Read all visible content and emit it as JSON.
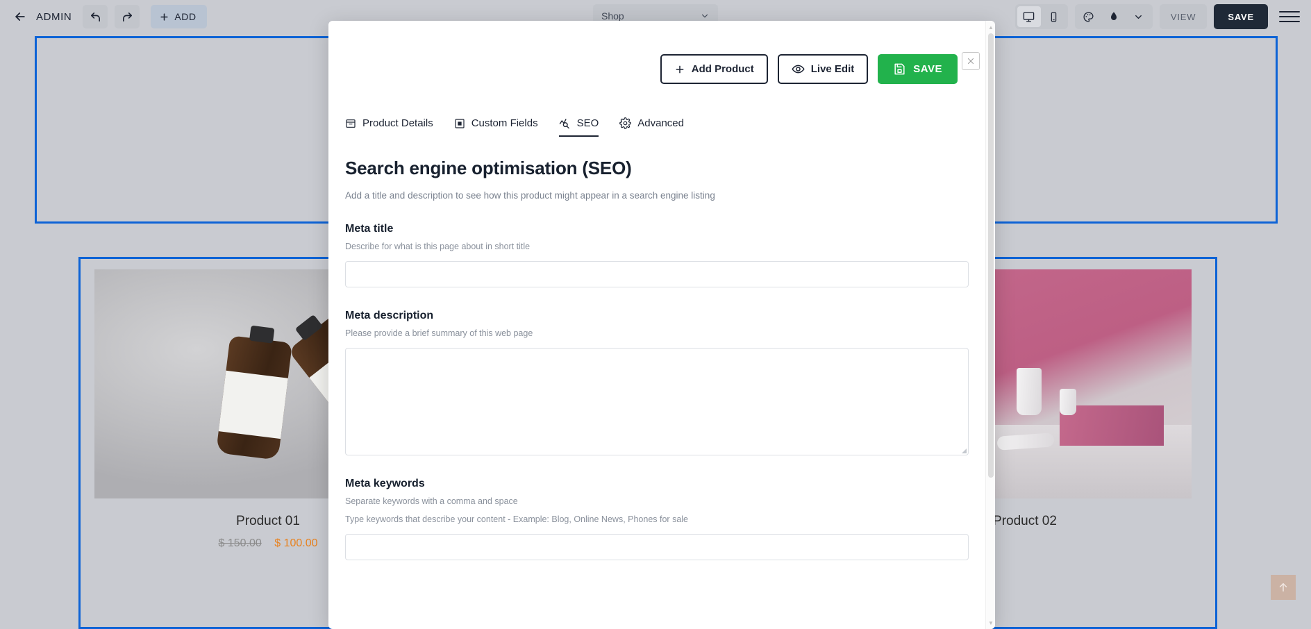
{
  "topbar": {
    "back_icon": "arrow-left-icon",
    "admin_label": "ADMIN",
    "undo_icon": "undo-icon",
    "redo_icon": "redo-icon",
    "add_label": "ADD",
    "page_selector": {
      "value": "Shop",
      "chevron": "chevron-down-icon"
    },
    "desktop_icon": "desktop-icon",
    "mobile_icon": "mobile-icon",
    "palette_icon": "palette-icon",
    "droplet_icon": "droplet-icon",
    "chevron_icon": "chevron-down-icon",
    "view_label": "VIEW",
    "save_label": "SAVE",
    "menu_icon": "hamburger-menu-icon"
  },
  "canvas": {
    "products": [
      {
        "title": "Product 01",
        "price_old": "$ 150.00",
        "price_new": "$ 100.00"
      },
      {
        "title": "Product 02",
        "price_old": "",
        "price_new": ""
      }
    ],
    "scroll_top_icon": "arrow-up-icon",
    "selection_color": "#0d63d6"
  },
  "modal": {
    "close_icon": "close-icon",
    "actions": {
      "add_product": {
        "label": "Add Product",
        "icon": "plus-icon"
      },
      "live_edit": {
        "label": "Live Edit",
        "icon": "eye-icon"
      },
      "save": {
        "label": "SAVE",
        "icon": "save-disk-icon",
        "color": "#22b24c"
      }
    },
    "tabs": [
      {
        "label": "Product Details",
        "icon": "box-icon",
        "active": false
      },
      {
        "label": "Custom Fields",
        "icon": "square-filled-icon",
        "active": false
      },
      {
        "label": "SEO",
        "icon": "seo-chart-icon",
        "active": true
      },
      {
        "label": "Advanced",
        "icon": "gear-icon",
        "active": false
      }
    ],
    "seo": {
      "heading": "Search engine optimisation (SEO)",
      "subtitle": "Add a title and description to see how this product might appear in a search engine listing",
      "meta_title": {
        "label": "Meta title",
        "hint": "Describe for what is this page about in short title",
        "value": "",
        "placeholder": ""
      },
      "meta_description": {
        "label": "Meta description",
        "hint": "Please provide a brief summary of this web page",
        "value": "",
        "placeholder": ""
      },
      "meta_keywords": {
        "label": "Meta keywords",
        "hint": "Separate keywords with a comma and space",
        "hint2": "Type keywords that describe your content - Example: Blog, Online News, Phones for sale",
        "value": "",
        "placeholder": ""
      }
    },
    "scrollbar": {
      "up_icon": "caret-up-icon",
      "down_icon": "caret-down-icon"
    }
  }
}
